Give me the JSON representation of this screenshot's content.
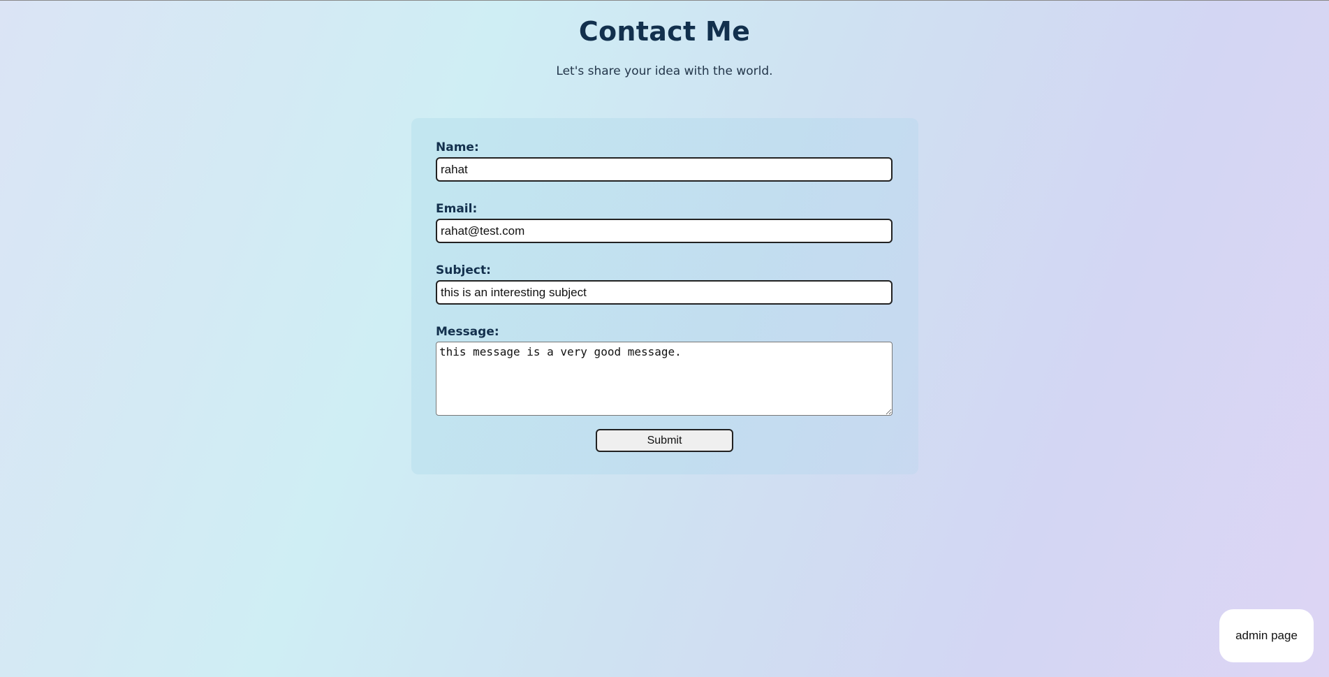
{
  "page": {
    "title": "Contact Me",
    "subtitle": "Let's share your idea with the world."
  },
  "form": {
    "name_label": "Name:",
    "name_value": "rahat",
    "email_label": "Email:",
    "email_value": "rahat@test.com",
    "subject_label": "Subject:",
    "subject_value": "this is an interesting subject",
    "message_label": "Message:",
    "message_value": "this message is a very good message.",
    "submit_label": "Submit"
  },
  "admin": {
    "button_label": "admin page"
  },
  "colors": {
    "heading": "#12304d",
    "button_bg": "#efefef",
    "admin_bg": "#ffffff"
  }
}
